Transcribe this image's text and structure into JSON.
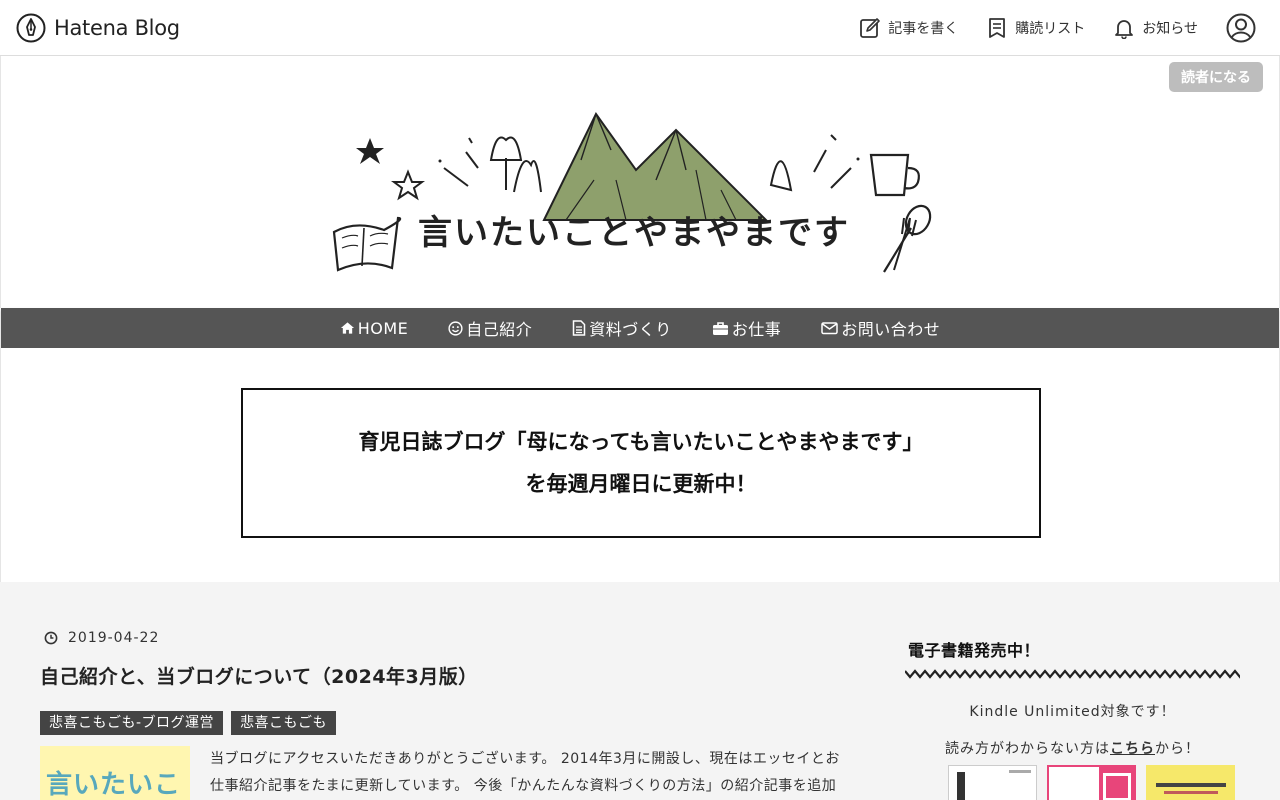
{
  "topbar": {
    "brand": "Hatena Blog",
    "nav": [
      {
        "label": "記事を書く",
        "icon": "edit-icon"
      },
      {
        "label": "購読リスト",
        "icon": "reading-list-icon"
      },
      {
        "label": "お知らせ",
        "icon": "bell-icon"
      }
    ],
    "avatar_icon": "user-icon"
  },
  "header": {
    "subscribe_label": "読者になる",
    "logo_text": "言いたいことやまやまです",
    "accent_color": "#8ea06c"
  },
  "navbar": {
    "items": [
      {
        "label": "HOME",
        "icon": "home-icon"
      },
      {
        "label": "自己紹介",
        "icon": "smile-icon"
      },
      {
        "label": "資料づくり",
        "icon": "document-icon"
      },
      {
        "label": "お仕事",
        "icon": "briefcase-icon"
      },
      {
        "label": "お問い合わせ",
        "icon": "mail-icon"
      }
    ],
    "bg_color": "#555555"
  },
  "notice": {
    "line1": "育児日誌ブログ「母になっても言いたいことやまやまです」",
    "line2": "を毎週月曜日に更新中！"
  },
  "post": {
    "date": "2019-04-22",
    "title": "自己紹介と、当ブログについて（2024年3月版）",
    "categories": [
      "悲喜こもごも-ブログ運営",
      "悲喜こもごも"
    ],
    "thumb_text": "言いたいこと",
    "excerpt": "当ブログにアクセスいただきありがとうございます。 2014年3月に開設し、現在はエッセイとお仕事紹介記事をたまに更新しています。 今後「かんたんな資料づくりの方法」の紹介記事を追加"
  },
  "sidebar": {
    "title": "電子書籍発売中！",
    "text1": "Kindle Unlimited対象です！",
    "text2_before": "読み方がわからない方は",
    "text2_link": "こちら",
    "text2_after": "から！",
    "books": [
      "book-cover-1",
      "book-cover-2",
      "book-cover-3"
    ]
  }
}
